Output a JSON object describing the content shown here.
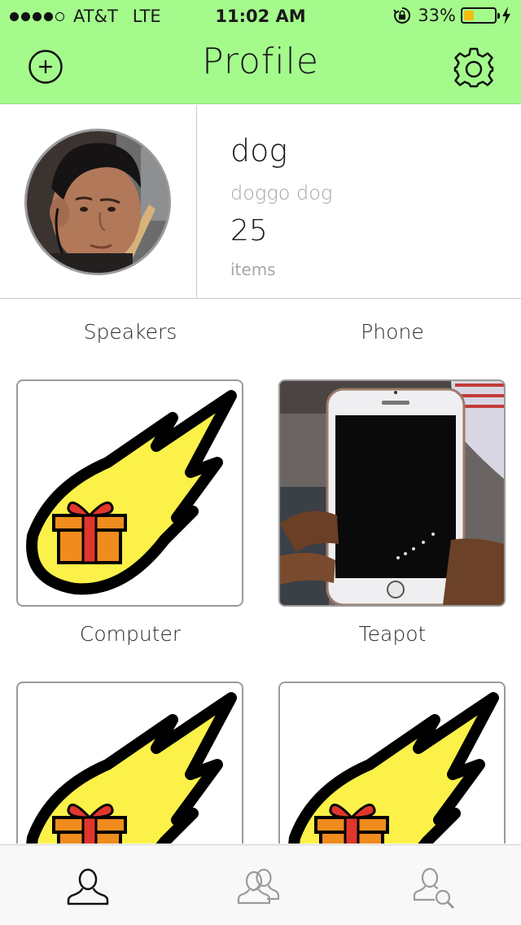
{
  "status_bar": {
    "carrier": "AT&T",
    "network": "LTE",
    "time": "11:02 AM",
    "battery": "33%",
    "battery_level": 0.33,
    "battery_color": "#f2bf12"
  },
  "header": {
    "title": "Profile",
    "add_icon": "plus-circle-icon",
    "settings_icon": "gear-icon",
    "background": "#a4fb8c"
  },
  "profile": {
    "name": "dog",
    "handle": "doggo dog",
    "item_count": "25",
    "item_count_label": "items"
  },
  "items": [
    {
      "label": "Speakers",
      "image": "gift-comet-placeholder"
    },
    {
      "label": "Phone",
      "image": "phone-photo"
    },
    {
      "label": "Computer",
      "image": "gift-comet-placeholder"
    },
    {
      "label": "Teapot",
      "image": "gift-comet-placeholder"
    }
  ],
  "tab_bar": {
    "tabs": [
      {
        "icon": "person-icon",
        "active": true
      },
      {
        "icon": "group-icon",
        "active": false
      },
      {
        "icon": "person-search-icon",
        "active": false
      }
    ]
  }
}
